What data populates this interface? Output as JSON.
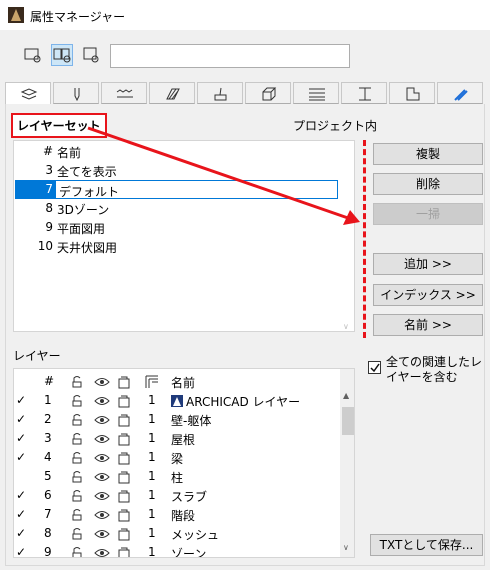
{
  "window": {
    "title": "属性マネージャー"
  },
  "layer_set": {
    "title": "レイヤーセット",
    "scope": "プロジェクト内",
    "columns": {
      "num": "#",
      "name": "名前"
    },
    "rows": [
      {
        "num": "3",
        "name": "全てを表示"
      },
      {
        "num": "7",
        "name": "デフォルト"
      },
      {
        "num": "8",
        "name": "3Dゾーン"
      },
      {
        "num": "9",
        "name": "平面図用"
      },
      {
        "num": "10",
        "name": "天井伏図用"
      }
    ],
    "selected_index": 1
  },
  "buttons": {
    "duplicate": "複製",
    "delete": "削除",
    "purge": "一掃",
    "add": "追加 >>",
    "index": "インデックス >>",
    "name": "名前 >>",
    "save_txt": "TXTとして保存..."
  },
  "layers": {
    "title": "レイヤー",
    "columns": {
      "num": "#",
      "name": "名前",
      "pen": ""
    },
    "rows": [
      {
        "check": "✓",
        "num": "1",
        "pen": "1",
        "name": "ARCHICAD レイヤー"
      },
      {
        "check": "✓",
        "num": "2",
        "pen": "1",
        "name": "壁-躯体"
      },
      {
        "check": "✓",
        "num": "3",
        "pen": "1",
        "name": "屋根"
      },
      {
        "check": "✓",
        "num": "4",
        "pen": "1",
        "name": "梁"
      },
      {
        "check": "",
        "num": "5",
        "pen": "1",
        "name": "柱"
      },
      {
        "check": "✓",
        "num": "6",
        "pen": "1",
        "name": "スラブ"
      },
      {
        "check": "✓",
        "num": "7",
        "pen": "1",
        "name": "階段"
      },
      {
        "check": "✓",
        "num": "8",
        "pen": "1",
        "name": "メッシュ"
      },
      {
        "check": "✓",
        "num": "9",
        "pen": "1",
        "name": "ゾーン"
      }
    ]
  },
  "include_related": {
    "label": "全ての関連したレイヤーを含む",
    "checked": true
  }
}
